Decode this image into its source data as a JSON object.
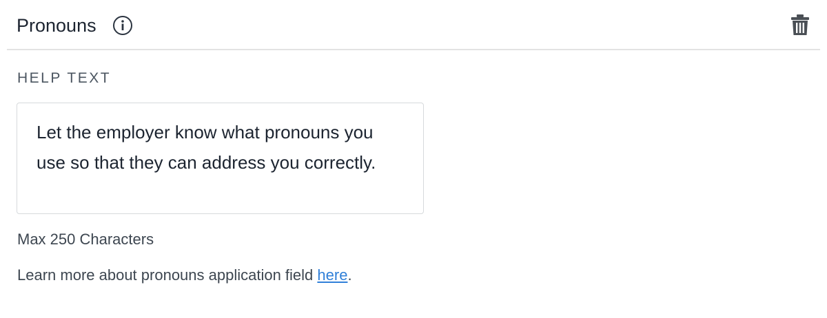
{
  "header": {
    "title": "Pronouns",
    "info_icon": "info-icon",
    "delete_icon": "trash-icon"
  },
  "help_text": {
    "label": "HELP TEXT",
    "value": "Let the employer know what pronouns you use so that they can address you correctly.",
    "max_chars_note": "Max 250 Characters"
  },
  "learn_more": {
    "prefix": "Learn more about pronouns application field ",
    "link_label": "here",
    "suffix": "."
  },
  "colors": {
    "link": "#2f7fd8",
    "divider": "#e3e3e3",
    "text": "#1c2430"
  }
}
